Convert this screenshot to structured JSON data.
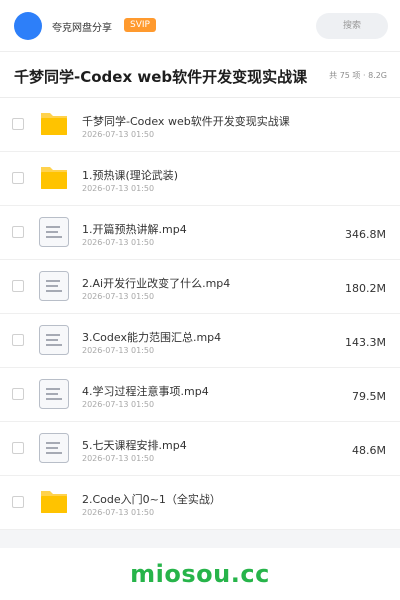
{
  "header": {
    "brand": "夸克网盘分享",
    "badge": "SVIP",
    "search_label": "搜索"
  },
  "title_bar": {
    "title": "千梦同学-Codex web软件开发变现实战课",
    "meta": "共 75 项 · 8.2G"
  },
  "files": [
    {
      "type": "folder",
      "name": "千梦同学-Codex web软件开发变现实战课",
      "date": "2026-07-13 01:50",
      "size": ""
    },
    {
      "type": "folder",
      "name": "1.预热课(理论武装)",
      "date": "2026-07-13 01:50",
      "size": ""
    },
    {
      "type": "video",
      "name": "1.开篇预热讲解.mp4",
      "date": "2026-07-13 01:50",
      "size": "346.8M"
    },
    {
      "type": "video",
      "name": "2.Ai开发行业改变了什么.mp4",
      "date": "2026-07-13 01:50",
      "size": "180.2M"
    },
    {
      "type": "video",
      "name": "3.Codex能力范围汇总.mp4",
      "date": "2026-07-13 01:50",
      "size": "143.3M"
    },
    {
      "type": "video",
      "name": "4.学习过程注意事项.mp4",
      "date": "2026-07-13 01:50",
      "size": "79.5M"
    },
    {
      "type": "video",
      "name": "5.七天课程安排.mp4",
      "date": "2026-07-13 01:50",
      "size": "48.6M"
    },
    {
      "type": "folder",
      "name": "2.Code入门0~1（全实战）",
      "date": "2026-07-13 01:50",
      "size": ""
    }
  ],
  "watermark": "miosou.cc",
  "colors": {
    "avatar": "#2d7ff9",
    "badge": "#ff9a2e",
    "folder_back": "#ffd24d",
    "folder_front": "#ffc300",
    "doc_border": "#b8bec8",
    "doc_fill": "#f7f8fa",
    "doc_lines": "#8a919c",
    "watermark": "#27b44a"
  }
}
